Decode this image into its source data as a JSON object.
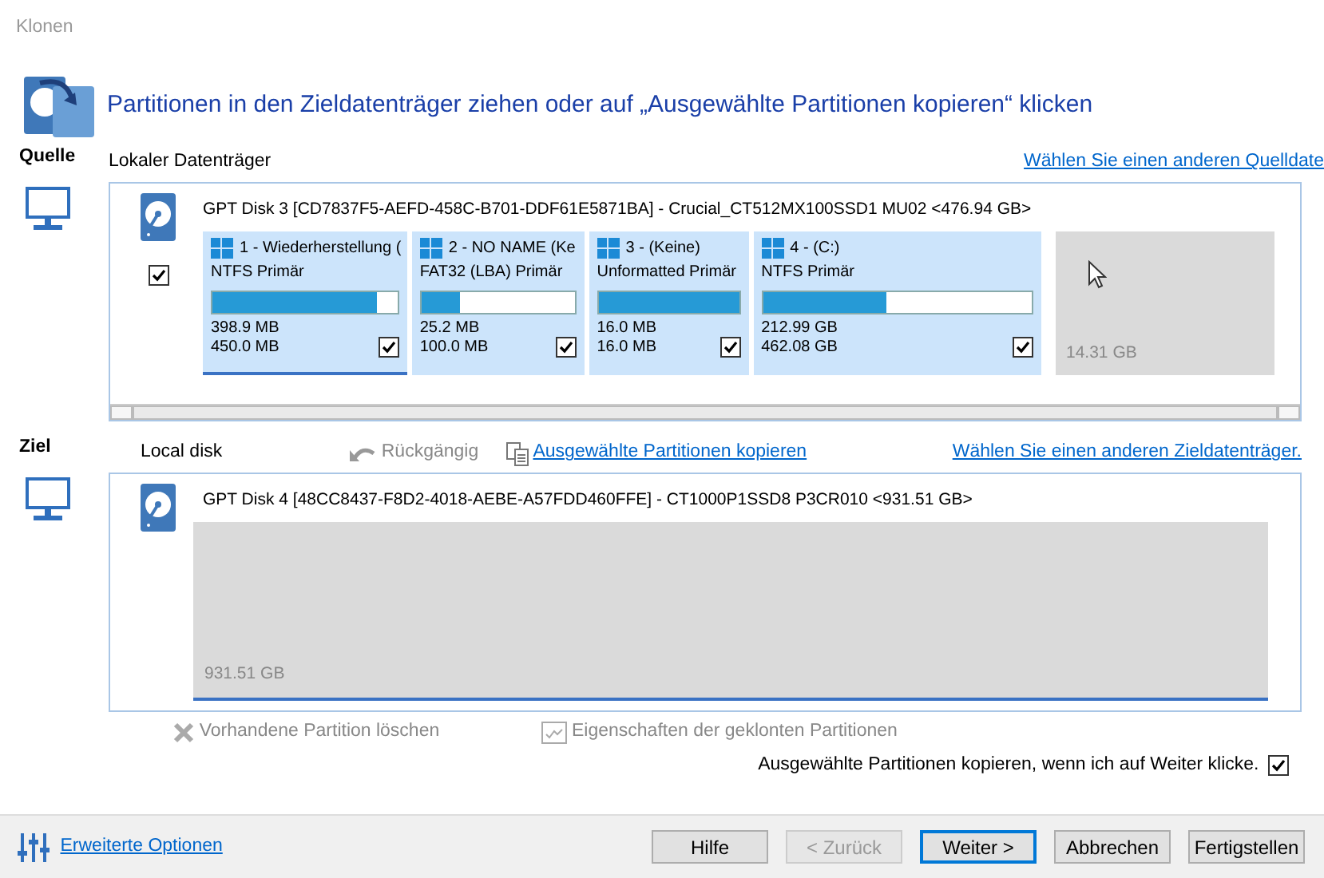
{
  "window": {
    "title": "Klonen"
  },
  "heading": "Partitionen in den Zieldatenträger ziehen oder auf „Ausgewählte Partitionen kopieren“ klicken",
  "source": {
    "label": "Quelle",
    "disk_type": "Lokaler Datenträger",
    "change_link": "Wählen Sie einen anderen Quelldate",
    "disk": {
      "title": "GPT Disk 3 [CD7837F5-AEFD-458C-B701-DDF61E5871BA] - Crucial_CT512MX100SSD1 MU02  <476.94 GB>",
      "checked": true,
      "partitions": [
        {
          "kind": "partition",
          "name": "1 - Wiederherstellung (",
          "fs": "NTFS Primär",
          "level": 0.886,
          "used": "398.9 MB",
          "total": "450.0 MB",
          "checked": true,
          "selected": true
        },
        {
          "kind": "partition",
          "name": "2 - NO NAME (Ke",
          "fs": "FAT32 (LBA) Primär",
          "level": 0.25,
          "used": "25.2 MB",
          "total": "100.0 MB",
          "checked": true,
          "selected": false
        },
        {
          "kind": "partition",
          "name": "3 -  (Keine)",
          "fs": "Unformatted Primär",
          "level": 1,
          "used": "16.0 MB",
          "total": "16.0 MB",
          "checked": true,
          "selected": false
        },
        {
          "kind": "partition",
          "name": "4 -  (C:)",
          "fs": "NTFS Primär",
          "level": 0.461,
          "used": "212.99 GB",
          "total": "462.08 GB",
          "checked": true,
          "selected": false
        },
        {
          "kind": "unallocated",
          "size": "14.31 GB",
          "selected": false
        }
      ]
    }
  },
  "target": {
    "label": "Ziel",
    "disk_type": "Local disk",
    "undo": {
      "label": "Rückgängig",
      "disabled": true
    },
    "copy_link": "Ausgewählte Partitionen kopieren",
    "change_link": "Wählen Sie einen anderen Zieldatenträger.",
    "disk": {
      "title": "GPT Disk 4 [48CC8437-F8D2-4018-AEBE-A57FDD460FFE] - CT1000P1SSD8 P3CR010  <931.51 GB>",
      "partitions": [
        {
          "kind": "unallocated",
          "size": "931.51 GB",
          "selected": true
        }
      ]
    }
  },
  "actions": [
    {
      "kind": "delete",
      "label": "Vorhandene Partition löschen",
      "disabled": true
    },
    {
      "kind": "properties",
      "label": "Eigenschaften der geklonten Partitionen",
      "disabled": true
    }
  ],
  "auto_copy": {
    "label": "Ausgewählte Partitionen kopieren, wenn ich auf Weiter klicke.",
    "checked": true
  },
  "footer": {
    "advanced_link": "Erweiterte Optionen",
    "buttons": [
      {
        "label": "Hilfe",
        "disabled": false,
        "default": false
      },
      {
        "label": "< Zurück",
        "disabled": true,
        "default": false
      },
      {
        "label": "Weiter >",
        "disabled": false,
        "default": true
      },
      {
        "label": "Abbrechen",
        "disabled": false,
        "default": false
      },
      {
        "label": "Fertigstellen",
        "disabled": false,
        "default": false
      }
    ]
  }
}
